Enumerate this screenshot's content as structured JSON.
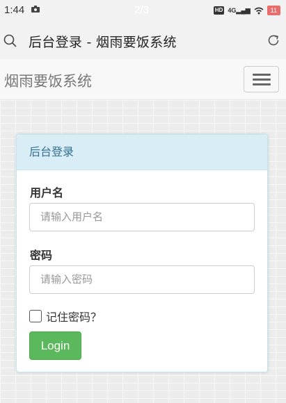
{
  "status_bar": {
    "time": "1:44",
    "page_indicator": "2/3",
    "hd_label": "HD",
    "signal_label": "4G",
    "battery": "11"
  },
  "browser": {
    "page_title": "后台登录 - 烟雨要饭系统"
  },
  "navbar": {
    "brand": "烟雨要饭系统"
  },
  "login_panel": {
    "heading": "后台登录",
    "username_label": "用户名",
    "username_placeholder": "请输入用户名",
    "password_label": "密码",
    "password_placeholder": "请输入密码",
    "remember_label": "记住密码？",
    "login_button": "Login"
  },
  "colors": {
    "panel_heading_bg": "#d9edf7",
    "panel_heading_text": "#31708f",
    "login_button": "#5cb85c"
  }
}
